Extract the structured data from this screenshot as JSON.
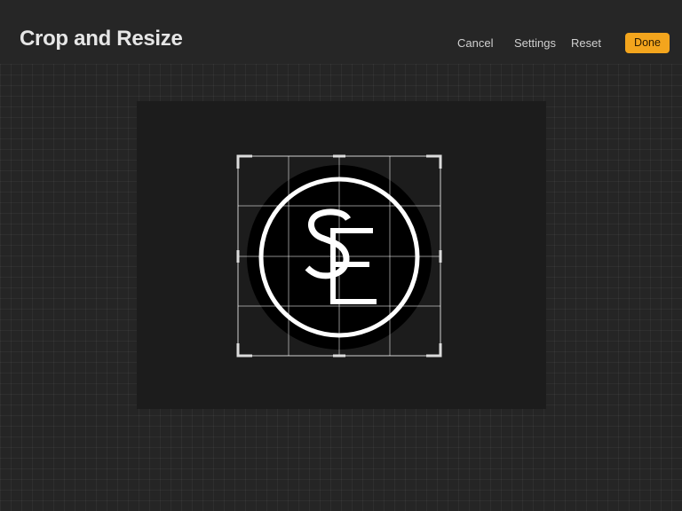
{
  "header": {
    "title": "Crop and Resize",
    "cancel_label": "Cancel",
    "settings_label": "Settings",
    "reset_label": "Reset",
    "done_label": "Done"
  },
  "colors": {
    "accent": "#f3a51d",
    "background": "#252525",
    "canvas": "#1c1c1c",
    "logo_fill": "#000000",
    "logo_stroke": "#ffffff"
  },
  "artwork": {
    "monogram_icon": "SL-monogram-coin-logo"
  },
  "crop": {
    "grid": "4x4 guide lines"
  }
}
